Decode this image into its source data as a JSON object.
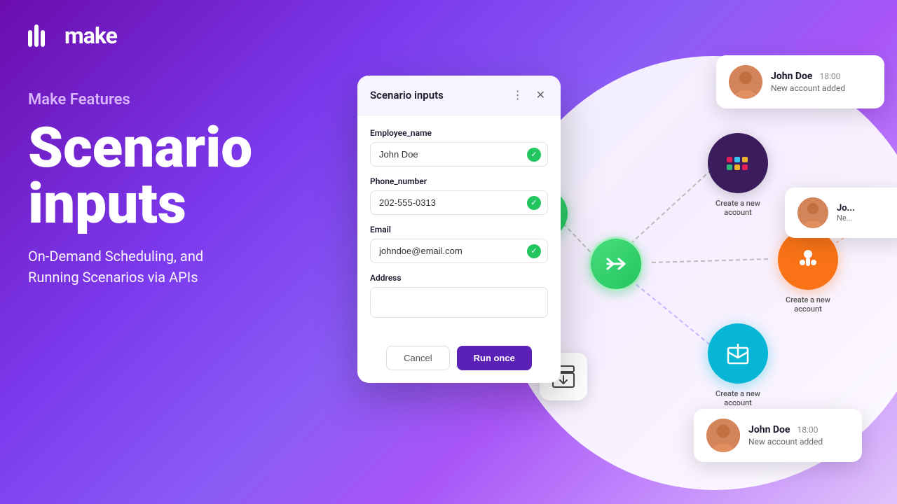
{
  "logo": {
    "text": "make"
  },
  "left": {
    "tagline": "Make Features",
    "title_line1": "Scenario",
    "title_line2": "inputs",
    "subtitle_line1": "On-Demand Scheduling, and",
    "subtitle_line2": "Running Scenarios via APIs"
  },
  "modal": {
    "title": "Scenario inputs",
    "fields": [
      {
        "label": "Employee_name",
        "value": "John Doe",
        "has_check": true,
        "placeholder": ""
      },
      {
        "label": "Phone_number",
        "value": "202-555-0313",
        "has_check": true,
        "placeholder": ""
      },
      {
        "label": "Email",
        "value": "johndoe@email.com",
        "has_check": true,
        "placeholder": ""
      },
      {
        "label": "Address",
        "value": "",
        "has_check": false,
        "placeholder": ""
      }
    ],
    "cancel_label": "Cancel",
    "run_label": "Run once"
  },
  "notifications": [
    {
      "id": "top",
      "name": "John Doe",
      "time": "18:00",
      "message": "New account added"
    },
    {
      "id": "bottom",
      "name": "John Doe",
      "time": "18:00",
      "message": "New account added"
    },
    {
      "id": "partial",
      "name": "Jo...",
      "time": "",
      "message": "Ne..."
    }
  ],
  "workflow": {
    "nodes": [
      {
        "id": "trigger",
        "label": ""
      },
      {
        "id": "router",
        "label": ""
      },
      {
        "id": "slack",
        "label": "Create a new account"
      },
      {
        "id": "hubspot",
        "label": "Create a new account"
      },
      {
        "id": "box",
        "label": "Create a new account"
      }
    ]
  }
}
